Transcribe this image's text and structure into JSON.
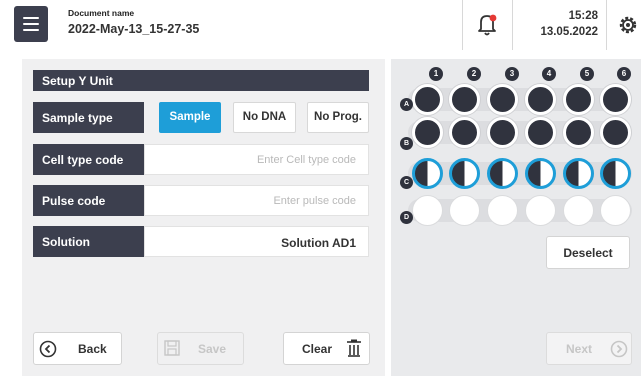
{
  "header": {
    "doc_label": "Document name",
    "doc_value": "2022-May-13_15-27-35",
    "time": "15:28",
    "date": "13.05.2022",
    "alert_dot_color": "#e53935"
  },
  "setup": {
    "title": "Setup Y Unit",
    "sample_type_label": "Sample type",
    "sample_type_options": [
      "Sample",
      "No DNA",
      "No Prog."
    ],
    "sample_type_selected": "Sample",
    "cell_type_label": "Cell type code",
    "cell_type_placeholder": "Enter Cell type code",
    "pulse_label": "Pulse code",
    "pulse_placeholder": "Enter pulse code",
    "solution_label": "Solution",
    "solution_value": "Solution AD1"
  },
  "buttons": {
    "back": "Back",
    "save": "Save",
    "clear": "Clear",
    "deselect": "Deselect",
    "next": "Next"
  },
  "plate": {
    "columns": [
      "1",
      "2",
      "3",
      "4",
      "5",
      "6"
    ],
    "rows": [
      {
        "letter": "A",
        "state": "filled"
      },
      {
        "letter": "B",
        "state": "filled"
      },
      {
        "letter": "C",
        "state": "selected-half"
      },
      {
        "letter": "D",
        "state": "empty"
      }
    ]
  },
  "colors": {
    "accent": "#1e9ed8",
    "dark": "#3c3f4e",
    "panel": "#f0f0f1"
  }
}
